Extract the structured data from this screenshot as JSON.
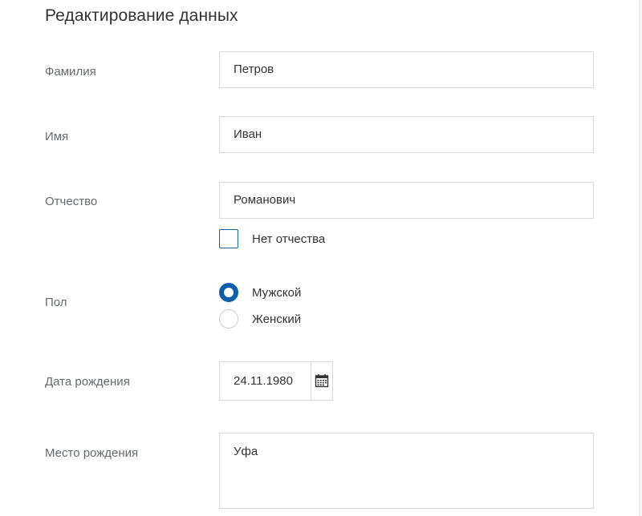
{
  "page": {
    "title": "Редактирование данных"
  },
  "form": {
    "last_name": {
      "label": "Фамилия",
      "value": "Петров"
    },
    "first_name": {
      "label": "Имя",
      "value": "Иван"
    },
    "middle_name": {
      "label": "Отчество",
      "value": "Романович"
    },
    "no_middle_name": {
      "label": "Нет отчества",
      "checked": false
    },
    "gender": {
      "label": "Пол",
      "options": [
        {
          "label": "Мужской",
          "checked": true
        },
        {
          "label": "Женский",
          "checked": false
        }
      ]
    },
    "birth_date": {
      "label": "Дата рождения",
      "value": "24.11.1980",
      "icon": "calendar-icon"
    },
    "birth_place": {
      "label": "Место рождения",
      "value": "Уфа"
    }
  },
  "colors": {
    "accent": "#0d5fa8",
    "border": "#d8dadd",
    "label": "#666a70",
    "text": "#333333"
  }
}
